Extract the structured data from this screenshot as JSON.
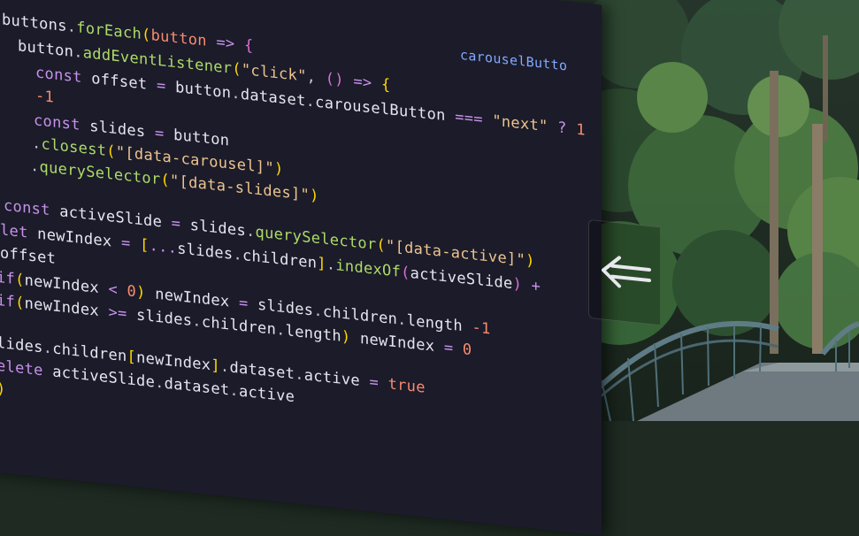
{
  "code": {
    "lines": [
      "buttons.forEach(button => {",
      "  button.addEventListener(\"click\", () => {",
      "    const offset = button.dataset.carouselButton === \"next\" ? 1",
      "    -1",
      "    const slides = button",
      "    .closest(\"[data-carousel]\")",
      "    .querySelector(\"[data-slides]\")",
      "const activeSlide = slides.querySelector(\"[data-active]\")",
      "let newIndex = [...slides.children].indexOf(activeSlide) +",
      "offset",
      "if(newIndex < 0) newIndex = slides.children.length -1",
      "if(newIndex >= slides.children.length) newIndex = 0",
      "lides.children[newIndex].dataset.active = true",
      "elete activeSlide.dataset.active",
      ")"
    ],
    "top_fragment": "carouselButto"
  },
  "carousel": {
    "prev_icon": "arrow-left-icon"
  },
  "colors": {
    "editor_bg": "#1b1b2a",
    "keyword": "#c792ea",
    "function": "#82aaff",
    "string": "#ecc48d",
    "number": "#f78c6c"
  }
}
